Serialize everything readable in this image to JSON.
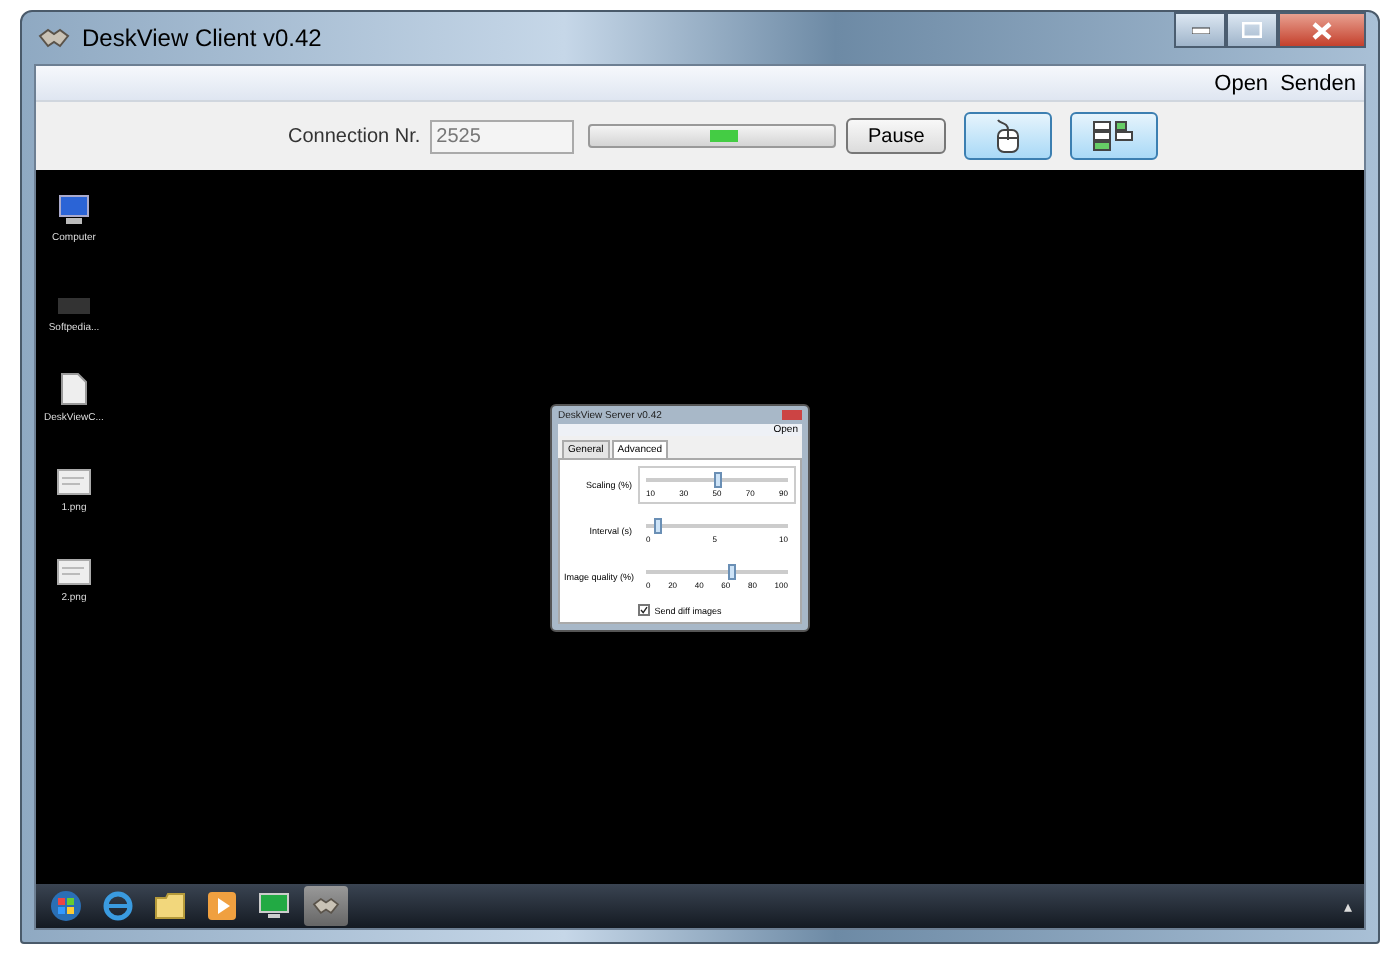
{
  "window": {
    "title": "DeskView Client v0.42"
  },
  "menu": [
    "Open",
    "Senden"
  ],
  "toolbar": {
    "connection_label": "Connection Nr.",
    "connection_value": "2525",
    "pause_button": "Pause",
    "progress": {
      "level": 0.55
    }
  },
  "desktop_icons": [
    {
      "kind": "computer",
      "label": "Computer"
    },
    {
      "kind": "app",
      "label": "Softpedia..."
    },
    {
      "kind": "file",
      "label": "DeskViewC..."
    },
    {
      "kind": "image",
      "label": "1.png"
    },
    {
      "kind": "image",
      "label": "2.png"
    }
  ],
  "dialog": {
    "title": "DeskView Server v0.42",
    "menu": "Open",
    "tabs": [
      {
        "label": "General",
        "selected": false
      },
      {
        "label": "Advanced",
        "selected": true
      }
    ],
    "sliders": [
      {
        "label": "Scaling (%)",
        "level": 0.5,
        "ticks": [
          "10",
          "30",
          "50",
          "70",
          "90"
        ],
        "boxed": true
      },
      {
        "label": "Interval (s)",
        "level": 0.08,
        "ticks": [
          "0",
          "5",
          "10"
        ],
        "boxed": false
      },
      {
        "label": "Image quality (%)",
        "level": 0.6,
        "ticks": [
          "0",
          "20",
          "40",
          "60",
          "80",
          "100"
        ],
        "boxed": false
      }
    ],
    "checkbox": {
      "label": "Send diff images",
      "checked": true
    }
  },
  "taskbar": [
    {
      "kind": "start",
      "active": false
    },
    {
      "kind": "browser",
      "active": false
    },
    {
      "kind": "folder",
      "active": false
    },
    {
      "kind": "media",
      "active": false
    },
    {
      "kind": "monitor",
      "active": false
    },
    {
      "kind": "handshake",
      "active": true
    }
  ],
  "tray": "▴"
}
